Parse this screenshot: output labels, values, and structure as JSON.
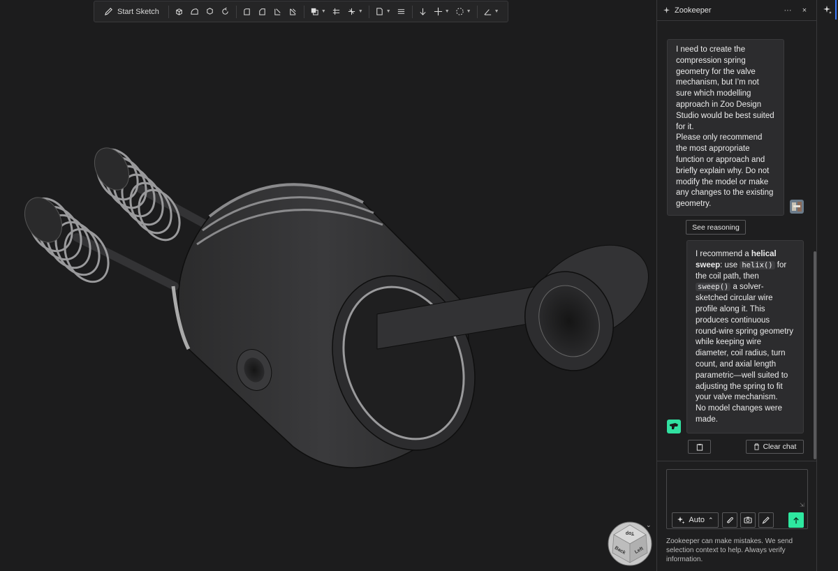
{
  "toolbar": {
    "start_sketch_label": "Start Sketch",
    "tools": [
      {
        "icon": "extrude-icon"
      },
      {
        "icon": "sweep-icon"
      },
      {
        "icon": "loft-icon"
      },
      {
        "icon": "revolve-icon"
      },
      {
        "icon": "fillet-icon"
      },
      {
        "icon": "chamfer-icon"
      },
      {
        "icon": "shell-icon"
      },
      {
        "icon": "hole-icon"
      },
      {
        "icon": "boolean-icon"
      },
      {
        "icon": "plane-icon"
      },
      {
        "icon": "helix-icon"
      },
      {
        "icon": "insert-icon"
      },
      {
        "icon": "appearance-icon"
      },
      {
        "icon": "translate-icon"
      },
      {
        "icon": "move-icon"
      },
      {
        "icon": "pattern-icon"
      },
      {
        "icon": "measure-icon"
      }
    ]
  },
  "navcube": {
    "faces": [
      "Top",
      "Back",
      "Left"
    ]
  },
  "panel": {
    "title": "Zookeeper",
    "menu_label": "···",
    "close_label": "×",
    "user_message": "I need to create the compression spring geometry for the valve mechanism, but I’m not sure which modelling approach in Zoo Design Studio would be best suited for it.",
    "user_message_2": "Please only recommend the most appropriate function or approach and briefly explain why. Do not modify the model or make any changes to the existing geometry.",
    "see_reasoning_label": "See reasoning",
    "bot_message": {
      "p1_a": "I recommend a ",
      "p1_bold": "helical sweep",
      "p1_b": ": use ",
      "code1": "helix()",
      "p1_c": " for the coil path, then ",
      "code2": "sweep()",
      "p1_d": " a solver-sketched circular wire profile along it. This produces continuous round-wire spring geometry while keeping wire diameter, coil radius, turn count, and axial length parametric—well suited to adjusting the spring to fit your valve mechanism.",
      "p2": "No model changes were made."
    },
    "clear_chat_label": "Clear chat",
    "composer": {
      "placeholder": "",
      "mode_label": "Auto"
    },
    "disclaimer": "Zookeeper can make mistakes. We send selection context to help. Always verify information."
  },
  "colors": {
    "accent_green": "#2ee8a0",
    "accent_blue": "#3d7bff",
    "panel_bg": "#1e1e1f",
    "viewport_bg": "#1c1c1d"
  }
}
